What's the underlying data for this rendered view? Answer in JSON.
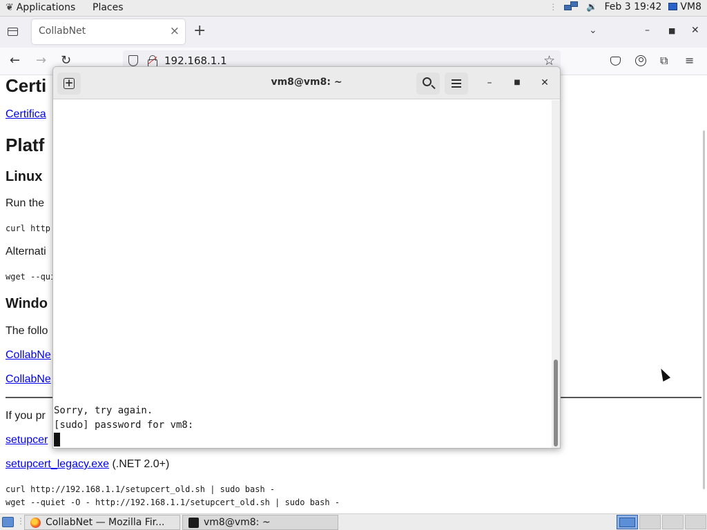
{
  "top_panel": {
    "applications": "Applications",
    "places": "Places",
    "clock": "Feb 3 19:42",
    "vm_label": "VM8"
  },
  "browser": {
    "tab_title": "CollabNet",
    "url": "192.168.1.1",
    "page": {
      "h1_cert": "Certi",
      "link_cert": "Certifica",
      "h1_platform": "Platf",
      "h2_linux": "Linux",
      "p_run": "Run the",
      "code_curl": "curl http",
      "p_alt": "Alternati",
      "code_wget": "wget --qui",
      "h2_windows": "Windo",
      "p_follow": "The follo",
      "link_collab1": "CollabNe",
      "link_collab2": "CollabNe",
      "p_ifyou": "If you pr",
      "link_setupcert": "setupcer",
      "link_legacy": "setupcert_legacy.exe",
      "legacy_note": " (.NET 2.0+)",
      "code_curl_old": "curl http://192.168.1.1/setupcert_old.sh | sudo bash -",
      "code_wget_old": "wget --quiet -O - http://192.168.1.1/setupcert_old.sh | sudo bash -"
    }
  },
  "terminal": {
    "title": "vm8@vm8: ~",
    "lines": [
      "Sorry, try again.",
      "[sudo] password for vm8:"
    ]
  },
  "taskbar": {
    "tasks": [
      {
        "label": "CollabNet — Mozilla Fir..."
      },
      {
        "label": "vm8@vm8: ~"
      }
    ]
  }
}
